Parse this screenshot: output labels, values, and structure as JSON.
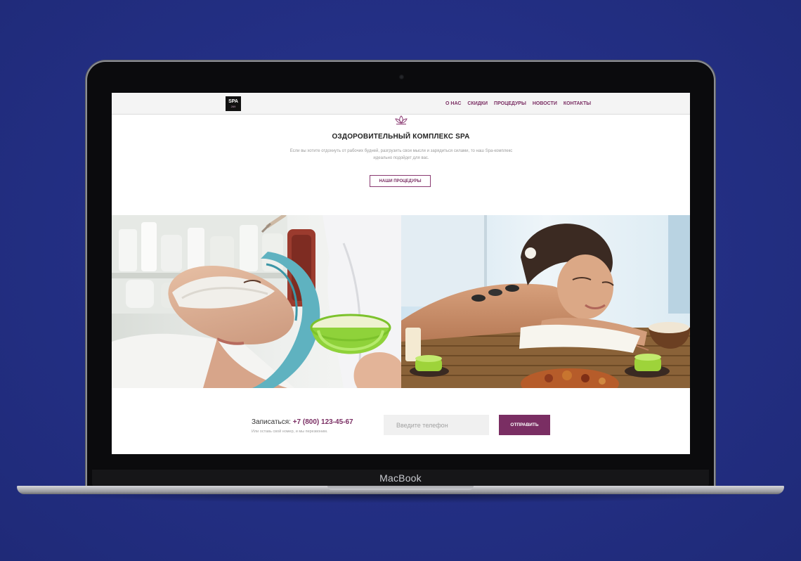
{
  "device": {
    "brand": "MacBook"
  },
  "nav": {
    "logo_text": "SPA",
    "logo_sub": "269",
    "items": [
      "О НАС",
      "СКИДКИ",
      "ПРОЦЕДУРЫ",
      "НОВОСТИ",
      "КОНТАКТЫ"
    ]
  },
  "hero": {
    "icon": "lotus-icon",
    "title": "ОЗДОРОВИТЕЛЬНЫЙ КОМПЛЕКС SPA",
    "text": "Если вы хотите отдохнуть от рабочих будней, разгрузить свои мысли и зарядиться силами, то наш Spa-комплекс идеально подойдет для вас.",
    "button_label": "НАШИ ПРОЦЕДУРЫ"
  },
  "photos": [
    {
      "name": "facial-mask-photo"
    },
    {
      "name": "stone-massage-photo"
    }
  ],
  "cta": {
    "label": "Записаться:",
    "phone": "+7 (800) 123-45-67",
    "subtext": "Или оставь свой номер, и мы перезвоним.",
    "input_placeholder": "Введите телефон",
    "submit_label": "ОТПРАВИТЬ"
  },
  "colors": {
    "accent": "#7a2e63",
    "background": "#243086"
  }
}
